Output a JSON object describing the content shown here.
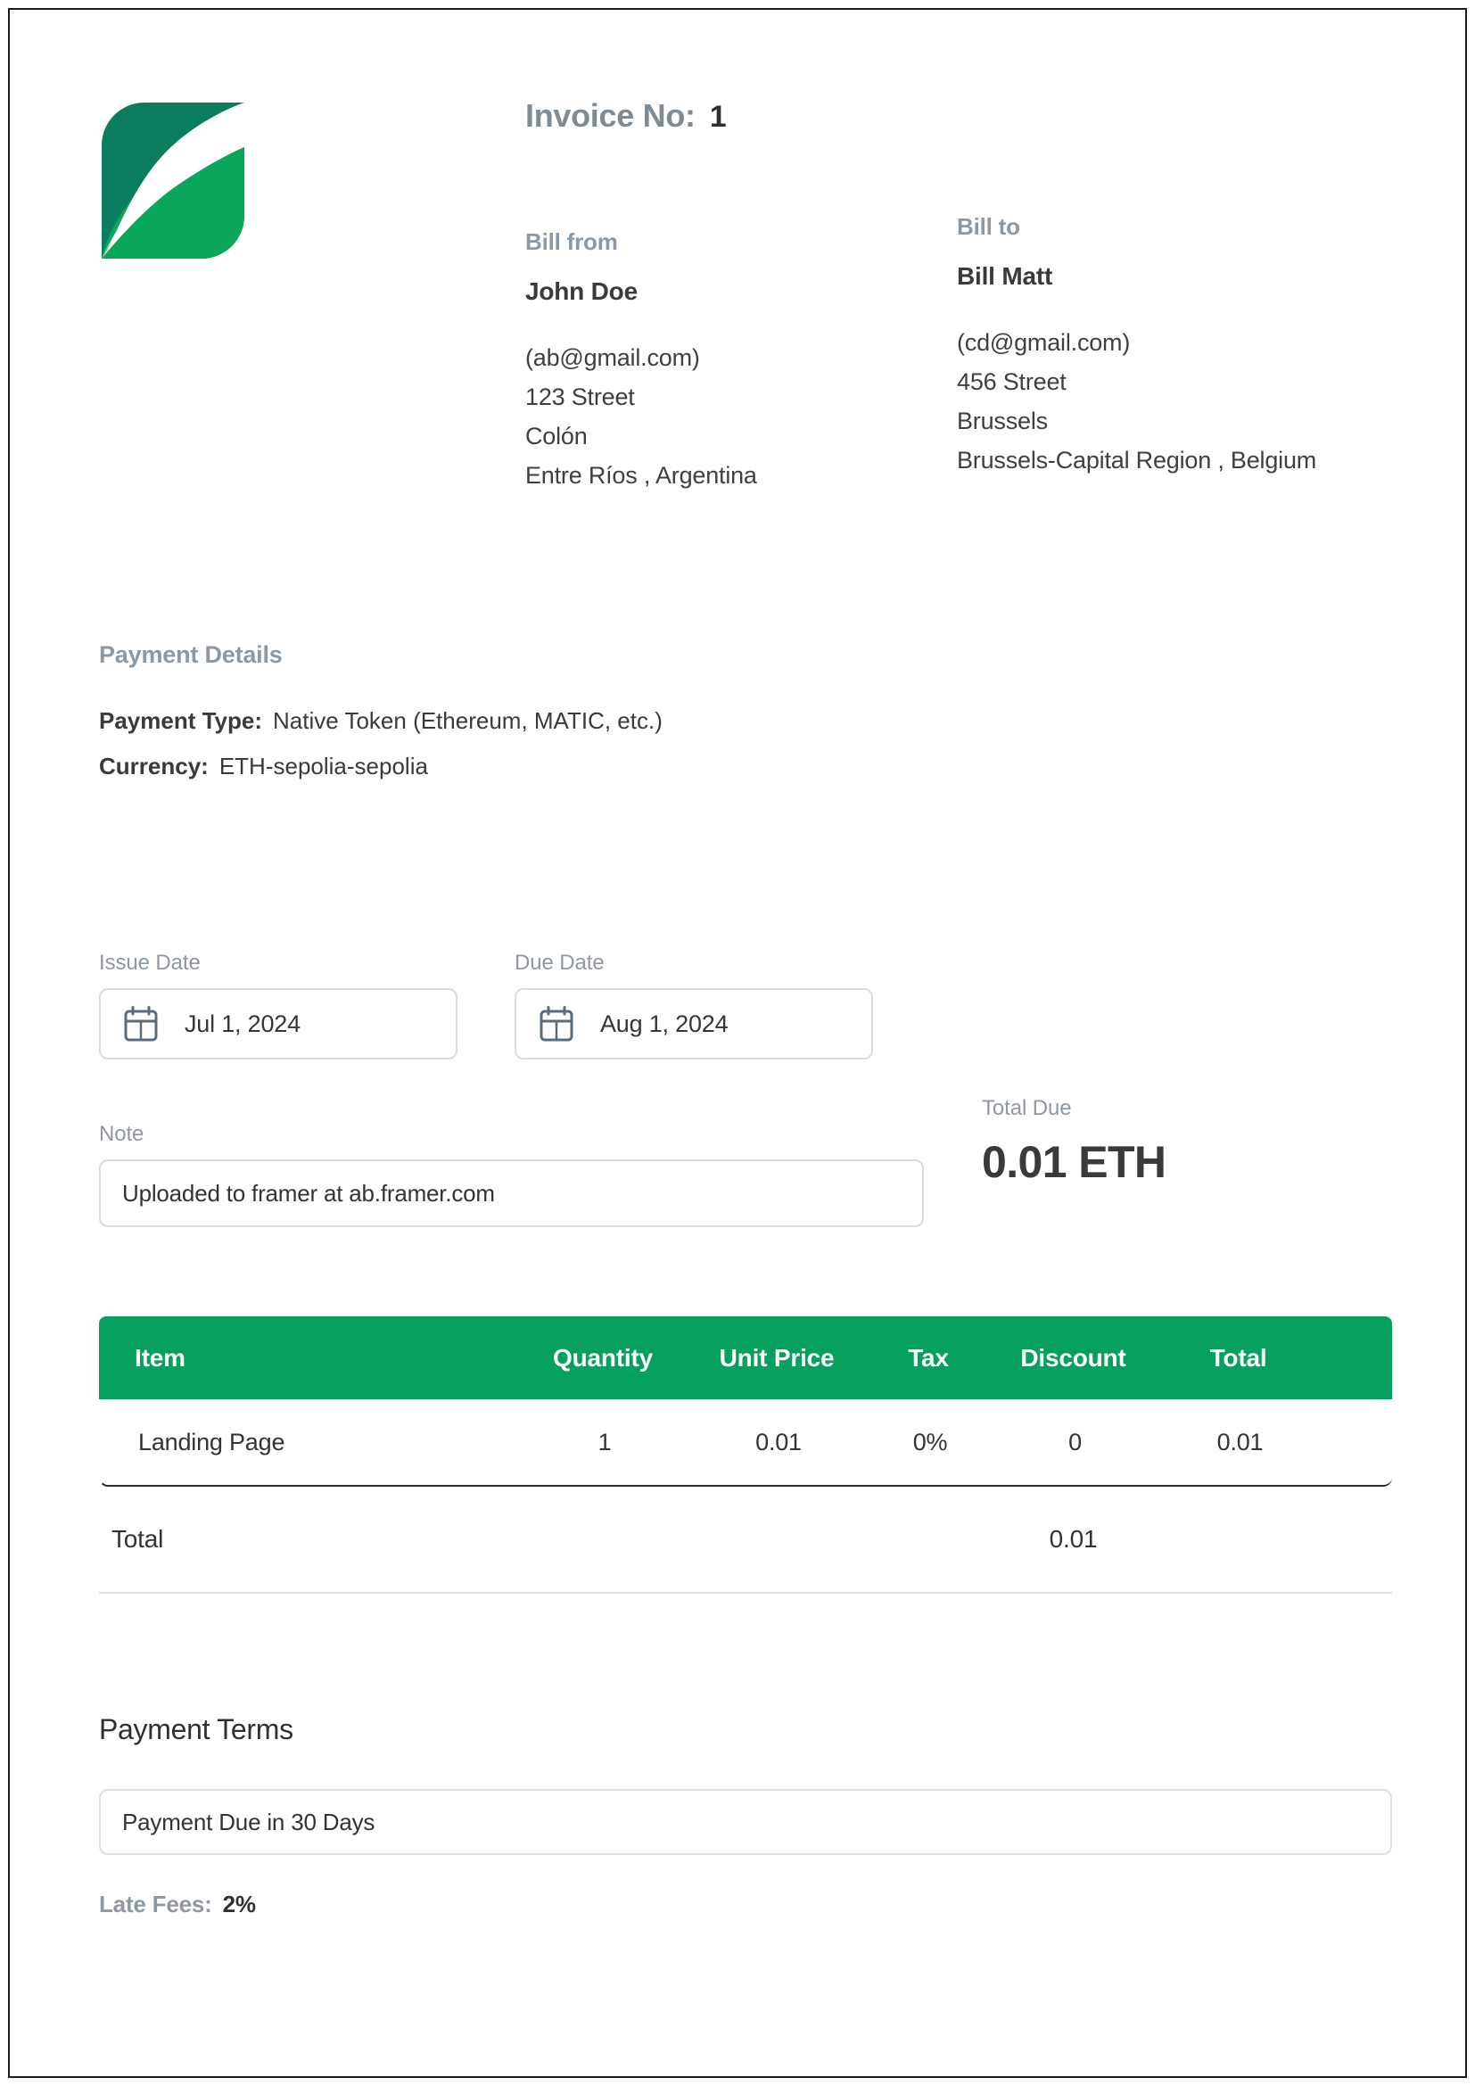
{
  "invoice": {
    "number_label": "Invoice No:",
    "number_value": "1"
  },
  "brand": {
    "logo_name": "leaf-logo",
    "dark_green": "#0a7d5f",
    "green": "#05a05e",
    "accent": "#05a05e"
  },
  "bill_from": {
    "label": "Bill from",
    "name": "John Doe",
    "email": "(ab@gmail.com)",
    "address_line1": "123 Street",
    "address_line2": "Colón",
    "address_line3": "Entre Ríos , Argentina"
  },
  "bill_to": {
    "label": "Bill to",
    "name": "Bill Matt",
    "email": "(cd@gmail.com)",
    "address_line1": "456 Street",
    "address_line2": "Brussels",
    "address_line3": "Brussels-Capital Region , Belgium"
  },
  "payment_details": {
    "title": "Payment Details",
    "type_label": "Payment Type:",
    "type_value": "Native Token (Ethereum, MATIC, etc.)",
    "currency_label": "Currency:",
    "currency_value": "ETH-sepolia-sepolia"
  },
  "dates": {
    "issue_label": "Issue Date",
    "issue_value": "Jul 1, 2024",
    "due_label": "Due Date",
    "due_value": "Aug 1, 2024",
    "calendar_icon": "calendar-icon"
  },
  "note": {
    "label": "Note",
    "value": "Uploaded to framer at ab.framer.com",
    "placeholder": "Note"
  },
  "total_due": {
    "label": "Total Due",
    "value": "0.01 ETH"
  },
  "items_table": {
    "columns": [
      "Item",
      "Quantity",
      "Unit Price",
      "Tax",
      "Discount",
      "Total"
    ],
    "rows": [
      {
        "item": "Landing Page",
        "quantity": "1",
        "unit_price": "0.01",
        "tax": "0%",
        "discount": "0",
        "total": "0.01"
      }
    ],
    "summary": {
      "label": "Total",
      "value": "0.01"
    }
  },
  "payment_terms": {
    "title": "Payment Terms",
    "value": "Payment Due in 30 Days",
    "placeholder": "Payment Terms",
    "late_fees_label": "Late Fees:",
    "late_fees_value": "2%"
  }
}
